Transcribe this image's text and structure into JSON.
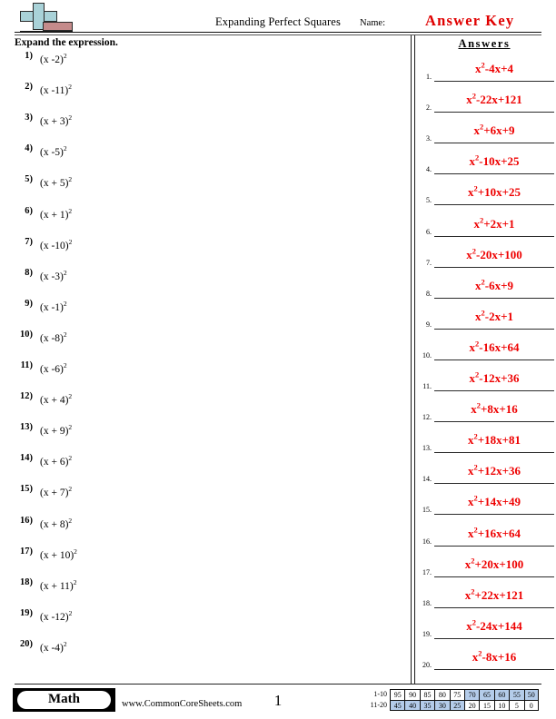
{
  "header": {
    "title": "Expanding Perfect Squares",
    "name_label": "Name:",
    "answer_key": "Answer Key",
    "logo_name": "math-plus-minus-logo",
    "colors": {
      "answer_key_red": "#e00000",
      "logo_blue": "#a9d2d8",
      "logo_red": "#c58b8b"
    }
  },
  "instruction": "Expand the expression.",
  "questions": [
    {
      "num": "1)",
      "expr": "(x -2)",
      "exp": "2"
    },
    {
      "num": "2)",
      "expr": "(x -11)",
      "exp": "2"
    },
    {
      "num": "3)",
      "expr": "(x + 3)",
      "exp": "2"
    },
    {
      "num": "4)",
      "expr": "(x -5)",
      "exp": "2"
    },
    {
      "num": "5)",
      "expr": "(x + 5)",
      "exp": "2"
    },
    {
      "num": "6)",
      "expr": "(x + 1)",
      "exp": "2"
    },
    {
      "num": "7)",
      "expr": "(x -10)",
      "exp": "2"
    },
    {
      "num": "8)",
      "expr": "(x -3)",
      "exp": "2"
    },
    {
      "num": "9)",
      "expr": "(x -1)",
      "exp": "2"
    },
    {
      "num": "10)",
      "expr": "(x -8)",
      "exp": "2"
    },
    {
      "num": "11)",
      "expr": "(x -6)",
      "exp": "2"
    },
    {
      "num": "12)",
      "expr": "(x + 4)",
      "exp": "2"
    },
    {
      "num": "13)",
      "expr": "(x + 9)",
      "exp": "2"
    },
    {
      "num": "14)",
      "expr": "(x + 6)",
      "exp": "2"
    },
    {
      "num": "15)",
      "expr": "(x + 7)",
      "exp": "2"
    },
    {
      "num": "16)",
      "expr": "(x + 8)",
      "exp": "2"
    },
    {
      "num": "17)",
      "expr": "(x + 10)",
      "exp": "2"
    },
    {
      "num": "18)",
      "expr": "(x + 11)",
      "exp": "2"
    },
    {
      "num": "19)",
      "expr": "(x -12)",
      "exp": "2"
    },
    {
      "num": "20)",
      "expr": "(x -4)",
      "exp": "2"
    }
  ],
  "answers_panel": {
    "heading": "Answers",
    "color": "#ee0000",
    "items": [
      {
        "num": "1.",
        "pre": "x",
        "exp": "2",
        "post": "-4x+4"
      },
      {
        "num": "2.",
        "pre": "x",
        "exp": "2",
        "post": "-22x+121"
      },
      {
        "num": "3.",
        "pre": "x",
        "exp": "2",
        "post": "+6x+9"
      },
      {
        "num": "4.",
        "pre": "x",
        "exp": "2",
        "post": "-10x+25"
      },
      {
        "num": "5.",
        "pre": "x",
        "exp": "2",
        "post": "+10x+25"
      },
      {
        "num": "6.",
        "pre": "x",
        "exp": "2",
        "post": "+2x+1"
      },
      {
        "num": "7.",
        "pre": "x",
        "exp": "2",
        "post": "-20x+100"
      },
      {
        "num": "8.",
        "pre": "x",
        "exp": "2",
        "post": "-6x+9"
      },
      {
        "num": "9.",
        "pre": "x",
        "exp": "2",
        "post": "-2x+1"
      },
      {
        "num": "10.",
        "pre": "x",
        "exp": "2",
        "post": "-16x+64"
      },
      {
        "num": "11.",
        "pre": "x",
        "exp": "2",
        "post": "-12x+36"
      },
      {
        "num": "12.",
        "pre": "x",
        "exp": "2",
        "post": "+8x+16"
      },
      {
        "num": "13.",
        "pre": "x",
        "exp": "2",
        "post": "+18x+81"
      },
      {
        "num": "14.",
        "pre": "x",
        "exp": "2",
        "post": "+12x+36"
      },
      {
        "num": "15.",
        "pre": "x",
        "exp": "2",
        "post": "+14x+49"
      },
      {
        "num": "16.",
        "pre": "x",
        "exp": "2",
        "post": "+16x+64"
      },
      {
        "num": "17.",
        "pre": "x",
        "exp": "2",
        "post": "+20x+100"
      },
      {
        "num": "18.",
        "pre": "x",
        "exp": "2",
        "post": "+22x+121"
      },
      {
        "num": "19.",
        "pre": "x",
        "exp": "2",
        "post": "-24x+144"
      },
      {
        "num": "20.",
        "pre": "x",
        "exp": "2",
        "post": "-8x+16"
      }
    ]
  },
  "footer": {
    "subject_badge": "Math",
    "site_url": "www.CommonCoreSheets.com",
    "page_number": "1",
    "score_grid": {
      "rows": [
        {
          "label": "1-10",
          "cells": [
            {
              "value": "95",
              "shaded": false
            },
            {
              "value": "90",
              "shaded": false
            },
            {
              "value": "85",
              "shaded": false
            },
            {
              "value": "80",
              "shaded": false
            },
            {
              "value": "75",
              "shaded": false
            },
            {
              "value": "70",
              "shaded": true
            },
            {
              "value": "65",
              "shaded": true
            },
            {
              "value": "60",
              "shaded": true
            },
            {
              "value": "55",
              "shaded": true
            },
            {
              "value": "50",
              "shaded": true
            }
          ]
        },
        {
          "label": "11-20",
          "cells": [
            {
              "value": "45",
              "shaded": true
            },
            {
              "value": "40",
              "shaded": true
            },
            {
              "value": "35",
              "shaded": true
            },
            {
              "value": "30",
              "shaded": true
            },
            {
              "value": "25",
              "shaded": true
            },
            {
              "value": "20",
              "shaded": false
            },
            {
              "value": "15",
              "shaded": false
            },
            {
              "value": "10",
              "shaded": false
            },
            {
              "value": "5",
              "shaded": false
            },
            {
              "value": "0",
              "shaded": false
            }
          ]
        }
      ],
      "shade_color": "#b4ccea"
    }
  }
}
